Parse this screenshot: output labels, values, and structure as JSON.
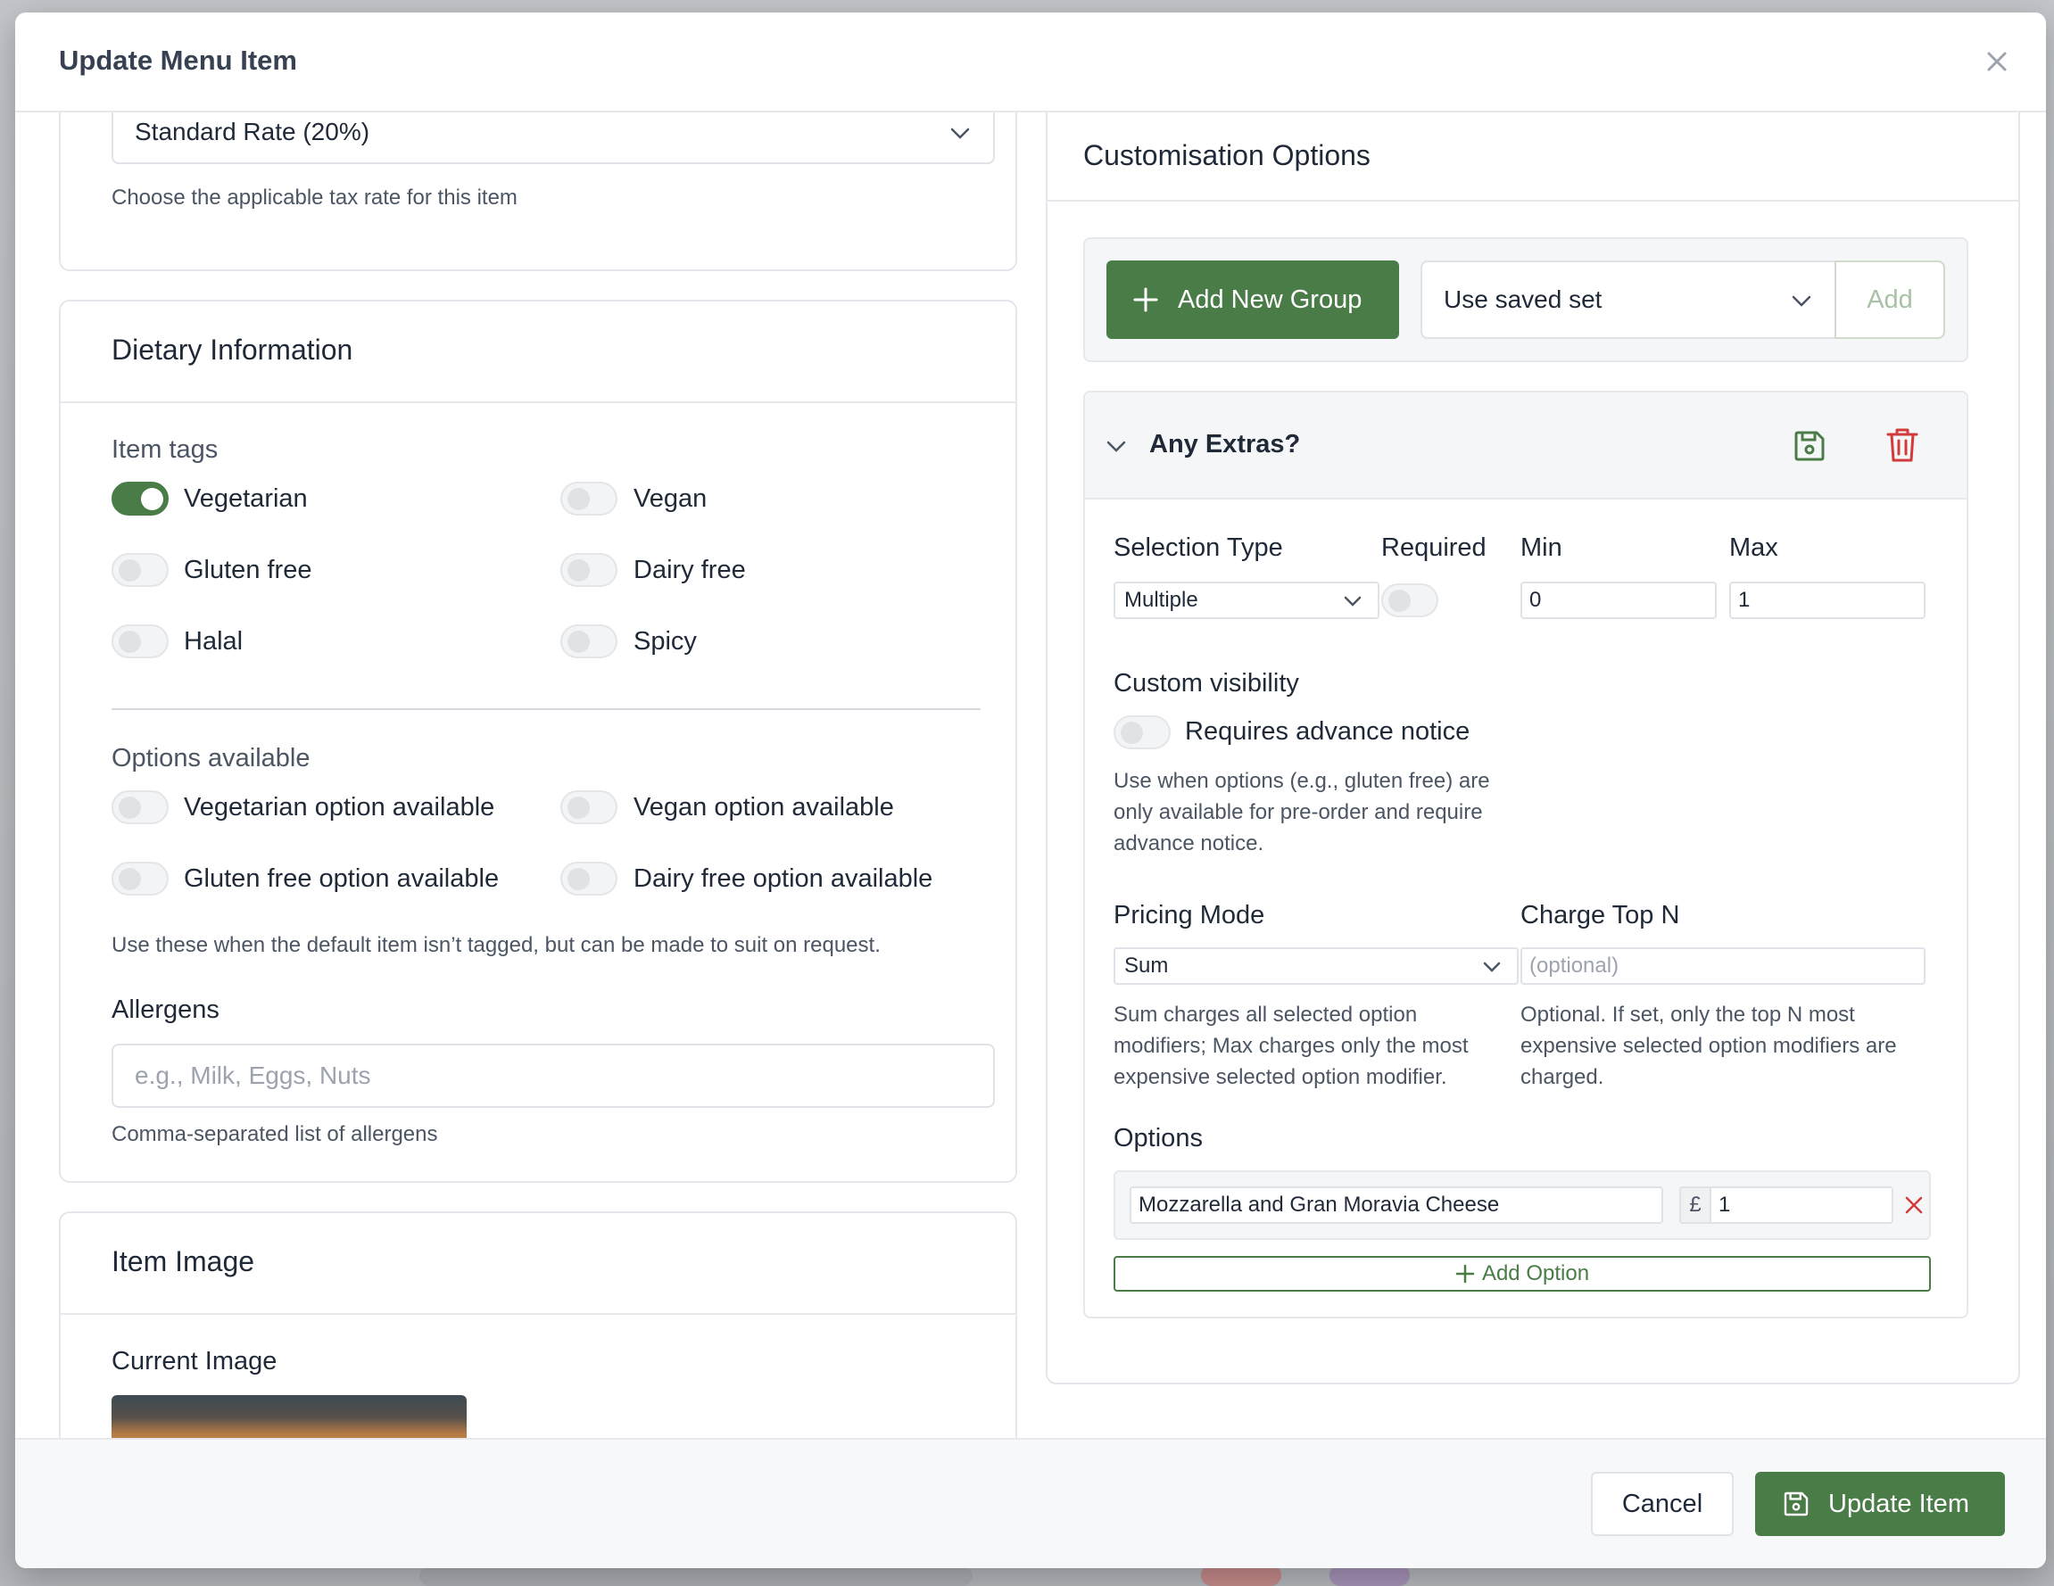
{
  "modal": {
    "title": "Update Menu Item"
  },
  "tax": {
    "selected": "Standard Rate (20%)",
    "hint": "Choose the applicable tax rate for this item"
  },
  "dietary": {
    "title": "Dietary Information",
    "tags_label": "Item tags",
    "tags": [
      {
        "label": "Vegetarian",
        "on": true
      },
      {
        "label": "Vegan",
        "on": false
      },
      {
        "label": "Gluten free",
        "on": false
      },
      {
        "label": "Dairy free",
        "on": false
      },
      {
        "label": "Halal",
        "on": false
      },
      {
        "label": "Spicy",
        "on": false
      }
    ],
    "options_label": "Options available",
    "options": [
      {
        "label": "Vegetarian option available",
        "on": false
      },
      {
        "label": "Vegan option available",
        "on": false
      },
      {
        "label": "Gluten free option available",
        "on": false
      },
      {
        "label": "Dairy free option available",
        "on": false
      }
    ],
    "options_hint": "Use these when the default item isn’t tagged, but can be made to suit on request.",
    "allergens_label": "Allergens",
    "allergens_placeholder": "e.g., Milk, Eggs, Nuts",
    "allergens_value": "",
    "allergens_hint": "Comma-separated list of allergens"
  },
  "item_image": {
    "title": "Item Image",
    "current_label": "Current Image"
  },
  "customisation": {
    "title": "Customisation Options",
    "add_group_label": "Add New Group",
    "saved_set_selected": "Use saved set",
    "add_label": "Add",
    "group": {
      "name": "Any Extras?",
      "selection_type_label": "Selection Type",
      "selection_type_value": "Multiple",
      "required_label": "Required",
      "required_on": false,
      "min_label": "Min",
      "min_value": "0",
      "max_label": "Max",
      "max_value": "1",
      "custom_visibility_label": "Custom visibility",
      "advance_notice_label": "Requires advance notice",
      "advance_notice_on": false,
      "advance_notice_hint": "Use when options (e.g., gluten free) are only available for pre-order and require advance notice.",
      "pricing_mode_label": "Pricing Mode",
      "pricing_mode_value": "Sum",
      "pricing_mode_hint": "Sum charges all selected option modifiers; Max charges only the most expensive selected option modifier.",
      "charge_top_n_label": "Charge Top N",
      "charge_top_n_placeholder": "(optional)",
      "charge_top_n_value": "",
      "charge_top_n_hint": "Optional. If set, only the top N most expensive selected option modifiers are charged.",
      "options_label": "Options",
      "options": [
        {
          "name": "Mozzarella and Gran Moravia Cheese",
          "currency": "£",
          "price": "1"
        }
      ],
      "add_option_label": "Add Option"
    }
  },
  "footer": {
    "cancel_label": "Cancel",
    "update_label": "Update Item"
  },
  "colors": {
    "accent": "#4a7c47",
    "danger": "#d13b3b"
  }
}
